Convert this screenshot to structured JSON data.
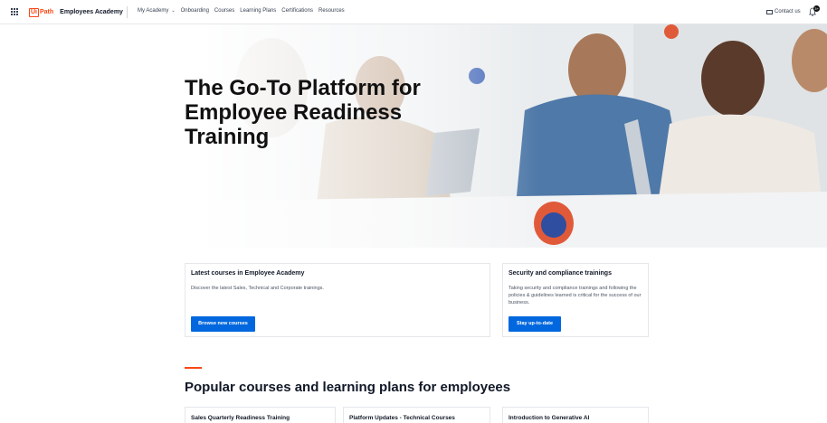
{
  "nav": {
    "brand": "Employees Academy",
    "logo_text": "Ui",
    "logo_path": "Path",
    "links": [
      "My Academy",
      "Onboarding",
      "Courses",
      "Learning Plans",
      "Certifications",
      "Resources"
    ],
    "contact": "Contact us",
    "badge": "3+"
  },
  "hero": {
    "title": "The Go-To Platform for Employee Readiness Training"
  },
  "cards": [
    {
      "title": "Latest courses in Employee Academy",
      "description": "Discover the latest Sales, Technical and Corporate trainings.",
      "button": "Browse new courses"
    },
    {
      "title": "Security and compliance trainings",
      "description": "Taking security and compliance trainings and following the policies & guidelines learned is critical for the success of our business.",
      "button": "Stay up-to-date"
    }
  ],
  "popular": {
    "title": "Popular courses and learning plans for employees",
    "items": [
      "Sales Quarterly Readiness Training",
      "Platform Updates - Technical Courses",
      "Introduction to Generative AI"
    ]
  },
  "colors": {
    "accent": "#fa4616",
    "primary": "#0067df"
  }
}
